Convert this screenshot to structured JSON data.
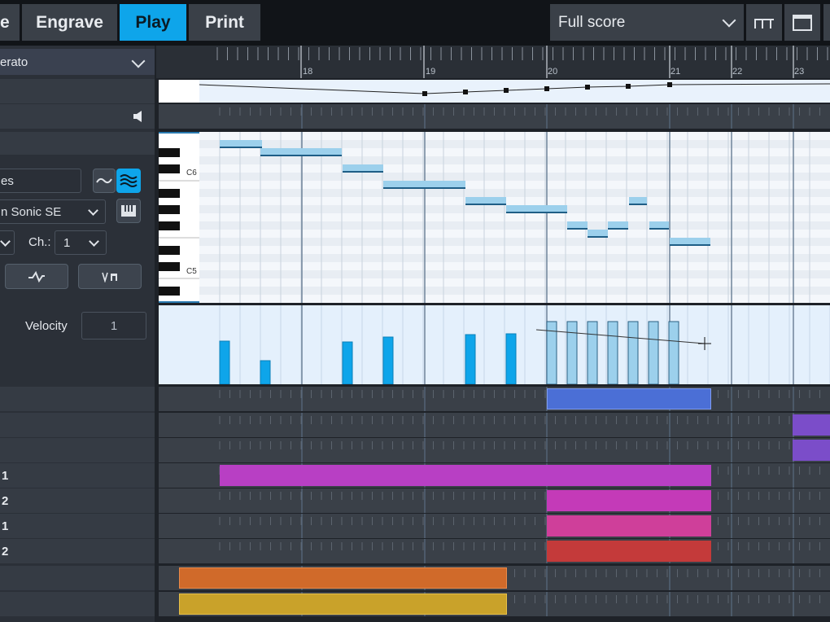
{
  "tabs": {
    "setup_partial": "e",
    "engrave": "Engrave",
    "play": "Play",
    "print": "Print"
  },
  "layout_select": {
    "value": "Full score"
  },
  "left": {
    "playing_technique_partial": "erato",
    "expression_map_partial": "es",
    "device_partial": "n Sonic SE",
    "channel_label": "Ch.:",
    "channel_value": "1",
    "velocity_label": "Velocity",
    "velocity_value": "1"
  },
  "ruler": {
    "bars": [
      "18",
      "19",
      "20",
      "21",
      "22",
      "23"
    ]
  },
  "keys": {
    "c6": "C6",
    "c5": "C5"
  },
  "track_labels": [
    "",
    "",
    "",
    "1",
    "2",
    "1",
    "2",
    "",
    ""
  ],
  "colors": {
    "accent": "#0ea5ea",
    "note": "#9cd0ec",
    "velocity_bar": "#0ea5ea",
    "velocity_selected": "#9cd0ec",
    "region_blue": "#4b6fd6",
    "region_purple": "#7b4dc9",
    "region_magenta": "#b83fc4",
    "region_pink": "#cf3f9a",
    "region_red": "#c43a3a",
    "region_orange": "#d06a2a",
    "region_yellow": "#c9a22a"
  },
  "icons": {
    "layout_options": "staff-layout-icon",
    "window": "window-icon",
    "speaker": "speaker-icon",
    "curve": "curve-icon",
    "waves": "waves-icon",
    "keyboard": "keyboard-icon",
    "edit_curve": "edit-curve-icon",
    "bow": "bow-icon"
  }
}
